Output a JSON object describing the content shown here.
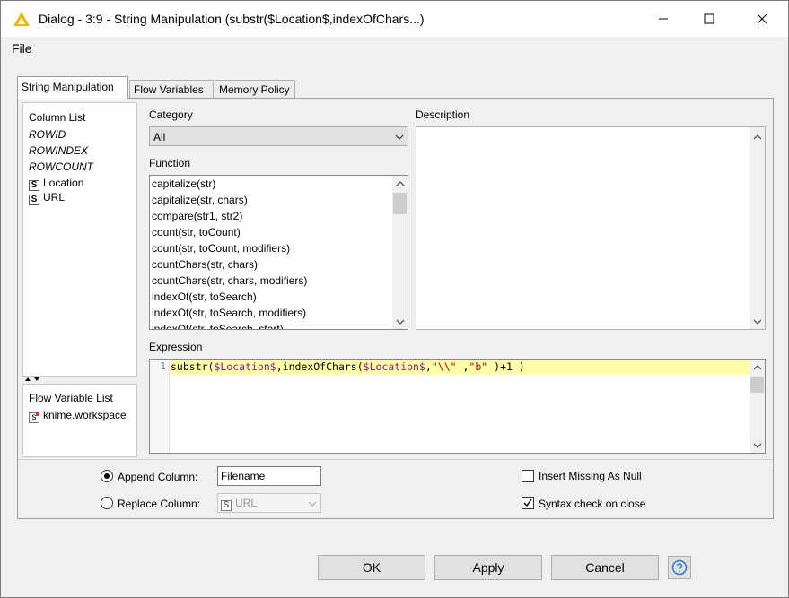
{
  "window": {
    "title": "Dialog - 3:9 - String Manipulation (substr($Location$,indexOfChars...)",
    "accent": "#f2b500"
  },
  "menu": {
    "file": "File"
  },
  "tabs": [
    {
      "label": "String Manipulation",
      "active": true
    },
    {
      "label": "Flow Variables",
      "active": false
    },
    {
      "label": "Memory Policy",
      "active": false
    }
  ],
  "column_list": {
    "header": "Column List",
    "items": [
      {
        "label": "ROWID",
        "type": "special"
      },
      {
        "label": "ROWINDEX",
        "type": "special"
      },
      {
        "label": "ROWCOUNT",
        "type": "special"
      },
      {
        "label": "Location",
        "type": "string",
        "badge": "S"
      },
      {
        "label": "URL",
        "type": "string",
        "badge": "S"
      }
    ]
  },
  "flow_variable_list": {
    "header": "Flow Variable List",
    "items": [
      {
        "label": "knime.workspace",
        "badge": "s"
      }
    ]
  },
  "category": {
    "label": "Category",
    "value": "All"
  },
  "function": {
    "label": "Function",
    "items": [
      "capitalize(str)",
      "capitalize(str, chars)",
      "compare(str1, str2)",
      "count(str, toCount)",
      "count(str, toCount, modifiers)",
      "countChars(str, chars)",
      "countChars(str, chars, modifiers)",
      "indexOf(str, toSearch)",
      "indexOf(str, toSearch, modifiers)",
      "indexOf(str, toSearch, start)"
    ]
  },
  "description": {
    "label": "Description"
  },
  "expression": {
    "label": "Expression",
    "line_number": "1",
    "code_parts": [
      {
        "text": "substr(",
        "kind": "fn"
      },
      {
        "text": "$Location$",
        "kind": "var"
      },
      {
        "text": ",indexOfChars(",
        "kind": "fn"
      },
      {
        "text": "$Location$",
        "kind": "var"
      },
      {
        "text": ",",
        "kind": "fn"
      },
      {
        "text": "\"\\\\\"",
        "kind": "str"
      },
      {
        "text": " ,",
        "kind": "fn"
      },
      {
        "text": "\"b\"",
        "kind": "str"
      },
      {
        "text": " )+1 )",
        "kind": "fn"
      }
    ]
  },
  "options": {
    "append_label": "Append Column:",
    "append_value": "Filename",
    "replace_label": "Replace Column:",
    "replace_badge": "S",
    "replace_value": "URL",
    "insert_missing_label": "Insert Missing As Null",
    "syntax_check_label": "Syntax check on close",
    "append_selected": true,
    "insert_missing_checked": false,
    "syntax_check_checked": true
  },
  "buttons": {
    "ok": "OK",
    "apply": "Apply",
    "cancel": "Cancel"
  }
}
